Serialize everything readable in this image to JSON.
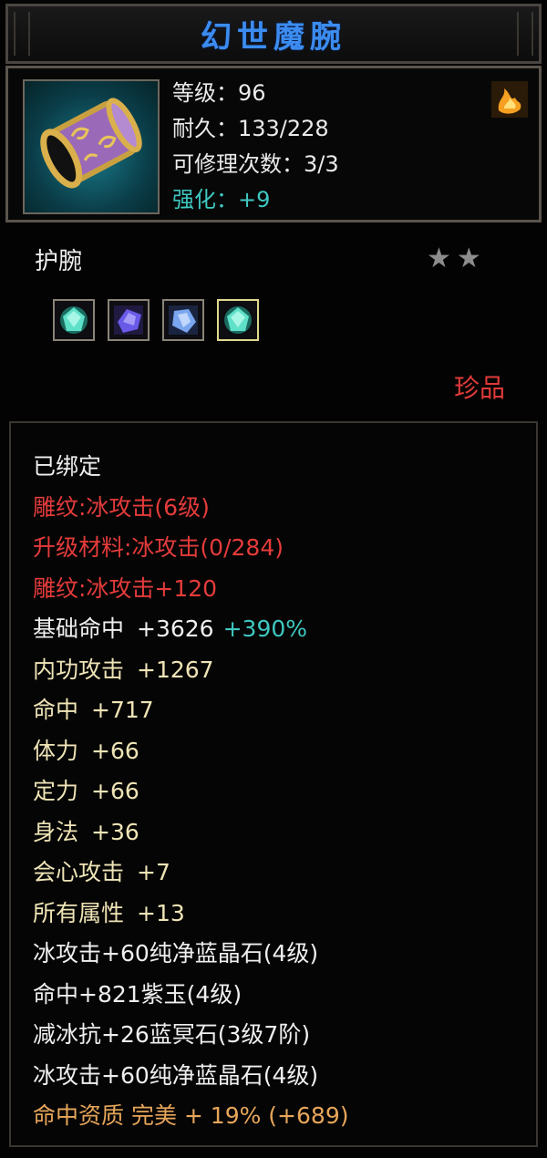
{
  "title": "幻世魔腕",
  "item": {
    "icon": "bracer-icon",
    "level": "等级：96",
    "durability": "耐久：133/228",
    "repair_times": "可修理次数：3/3",
    "enhance": "强化：+9",
    "corner_icon": "fire-icon"
  },
  "item_type": "护腕",
  "stars": "★★",
  "star_count": 2,
  "gems": [
    {
      "name": "green-gem-icon",
      "color": "#37c8b0"
    },
    {
      "name": "purple-gem-icon",
      "color": "#6a5ae8"
    },
    {
      "name": "blue-gem-icon",
      "color": "#6a9ae8"
    },
    {
      "name": "green-gem-icon",
      "color": "#37c8b0"
    }
  ],
  "rarity": "珍品",
  "attributes": [
    {
      "label": "已绑定",
      "color": "white"
    },
    {
      "label": "雕纹:冰攻击(6级)",
      "color": "red"
    },
    {
      "label": "升级材料:冰攻击(0/284)",
      "color": "red"
    },
    {
      "label": "雕纹:冰攻击+120",
      "color": "red"
    },
    {
      "label": "基础命中",
      "value": "+3626",
      "bonus": "+390%",
      "color": "white"
    },
    {
      "label": "内功攻击",
      "value": "+1267",
      "color": "gold"
    },
    {
      "label": "命中",
      "value": "+717",
      "color": "gold"
    },
    {
      "label": "体力",
      "value": "+66",
      "color": "gold"
    },
    {
      "label": "定力",
      "value": "+66",
      "color": "gold"
    },
    {
      "label": "身法",
      "value": "+36",
      "color": "gold"
    },
    {
      "label": "会心攻击",
      "value": "+7",
      "color": "gold"
    },
    {
      "label": "所有属性",
      "value": "+13",
      "color": "gold"
    },
    {
      "label": "冰攻击+60纯净蓝晶石(4级)",
      "color": "white"
    },
    {
      "label": "命中+821紫玉(4级)",
      "color": "white"
    },
    {
      "label": "减冰抗+26蓝冥石(3级7阶)",
      "color": "white"
    },
    {
      "label": "冰攻击+60纯净蓝晶石(4级)",
      "color": "white"
    },
    {
      "label": "命中资质 完美 + 19% (+689)",
      "color": "orange"
    }
  ],
  "colors": {
    "title_blue": "#3c8cf0",
    "enhance_cyan": "#3fc7c0",
    "rarity_red": "#e03a3a",
    "engrave_red": "#e43b3b",
    "stat_gold": "#efe4b6",
    "quality_orange": "#e8a65a"
  }
}
